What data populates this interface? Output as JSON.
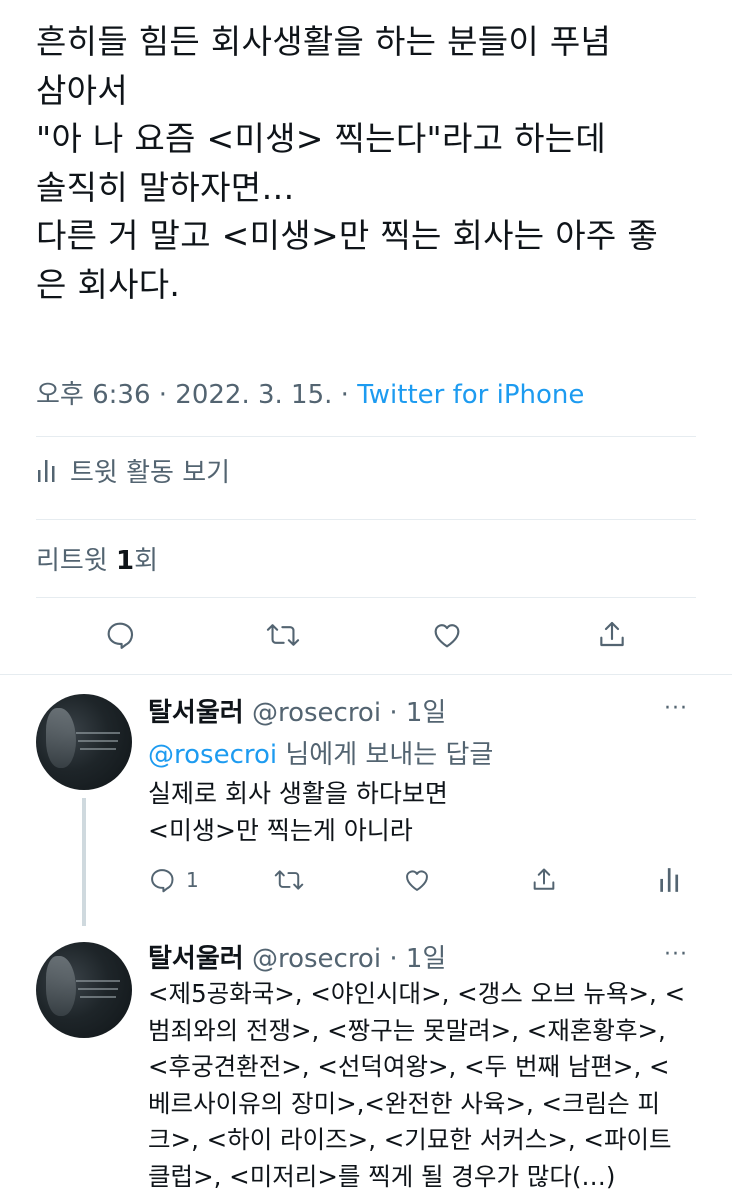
{
  "tweet": {
    "lines": [
      "흔히들 힘든 회사생활을 하는 분들이 푸념",
      "삼아서",
      "\"아 나 요즘 <미생> 찍는다\"라고 하는데",
      "솔직히 말하자면…",
      "다른 거 말고 <미생>만 찍는 회사는 아주 좋",
      "은 회사다."
    ],
    "timestamp": "오후 6:36 · 2022. 3. 15. · ",
    "source": "Twitter for iPhone",
    "activity_label": "트윗 활동 보기",
    "retweets_prefix": "리트윗 ",
    "retweets_count": "1",
    "retweets_suffix": "회"
  },
  "reply1": {
    "name": "탈서울러",
    "handle": " @rosecroi · 1일",
    "more": "···",
    "replying_to_handle": "@rosecroi",
    "replying_to_text": " 님에게 보내는 답글",
    "lines": [
      "실제로 회사 생활을 하다보면",
      "<미생>만 찍는게 아니라"
    ],
    "reply_count": "1"
  },
  "reply2": {
    "name": "탈서울러",
    "handle": " @rosecroi · 1일",
    "more": "···",
    "lines": [
      "<제5공화국>, <야인시대>, <갱스 오브 뉴욕>, <",
      "범죄와의 전쟁>, <짱구는 못말려>, <재혼황후>,",
      "<후궁견환전>, <선덕여왕>, <두 번째 남편>, <",
      "베르사이유의 장미>,<완전한 사육>, <크림슨 피",
      "크>, <하이 라이즈>, <기묘한 서커스>, <파이트",
      "클럽>, <미저리>를 찍게 될 경우가 많다(…)"
    ]
  },
  "icons": {
    "reply": "speech-bubble-icon",
    "retweet": "retweet-arrows-icon",
    "like": "heart-icon",
    "share": "share-upload-icon",
    "analytics": "bar-chart-icon",
    "more": "ellipsis-icon"
  },
  "colors": {
    "link": "#1d9bf0",
    "muted": "#536471",
    "text": "#0f1419",
    "divider": "#e6ecf0"
  }
}
